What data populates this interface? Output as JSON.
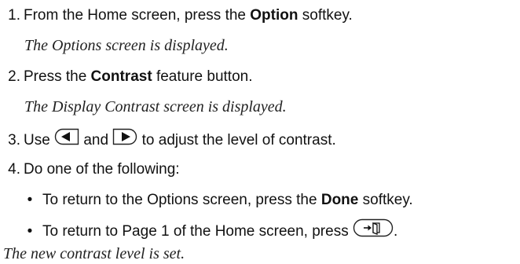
{
  "steps": [
    {
      "number": "1.",
      "before": "From the Home screen, press the ",
      "bold": "Option",
      "after": " softkey.",
      "result": "The Options screen is displayed."
    },
    {
      "number": "2.",
      "before": "Press the ",
      "bold": "Contrast",
      "after": " feature button.",
      "result": "The Display Contrast screen is displayed."
    },
    {
      "number": "3.",
      "use": "Use ",
      "and": " and ",
      "after": " to adjust the level of contrast.",
      "icons": [
        "left-arrow-key-icon",
        "right-arrow-key-icon"
      ]
    },
    {
      "number": "4.",
      "text": "Do one of the following:",
      "bullets": [
        {
          "before": "To return to the Options screen, press the ",
          "bold": "Done",
          "after": " softkey."
        },
        {
          "before": "To return to Page 1 of the Home screen, press ",
          "after": ".",
          "icon": "home-key-icon"
        }
      ]
    }
  ],
  "final_result": "The new contrast level is set.",
  "bullet_glyph": "•"
}
